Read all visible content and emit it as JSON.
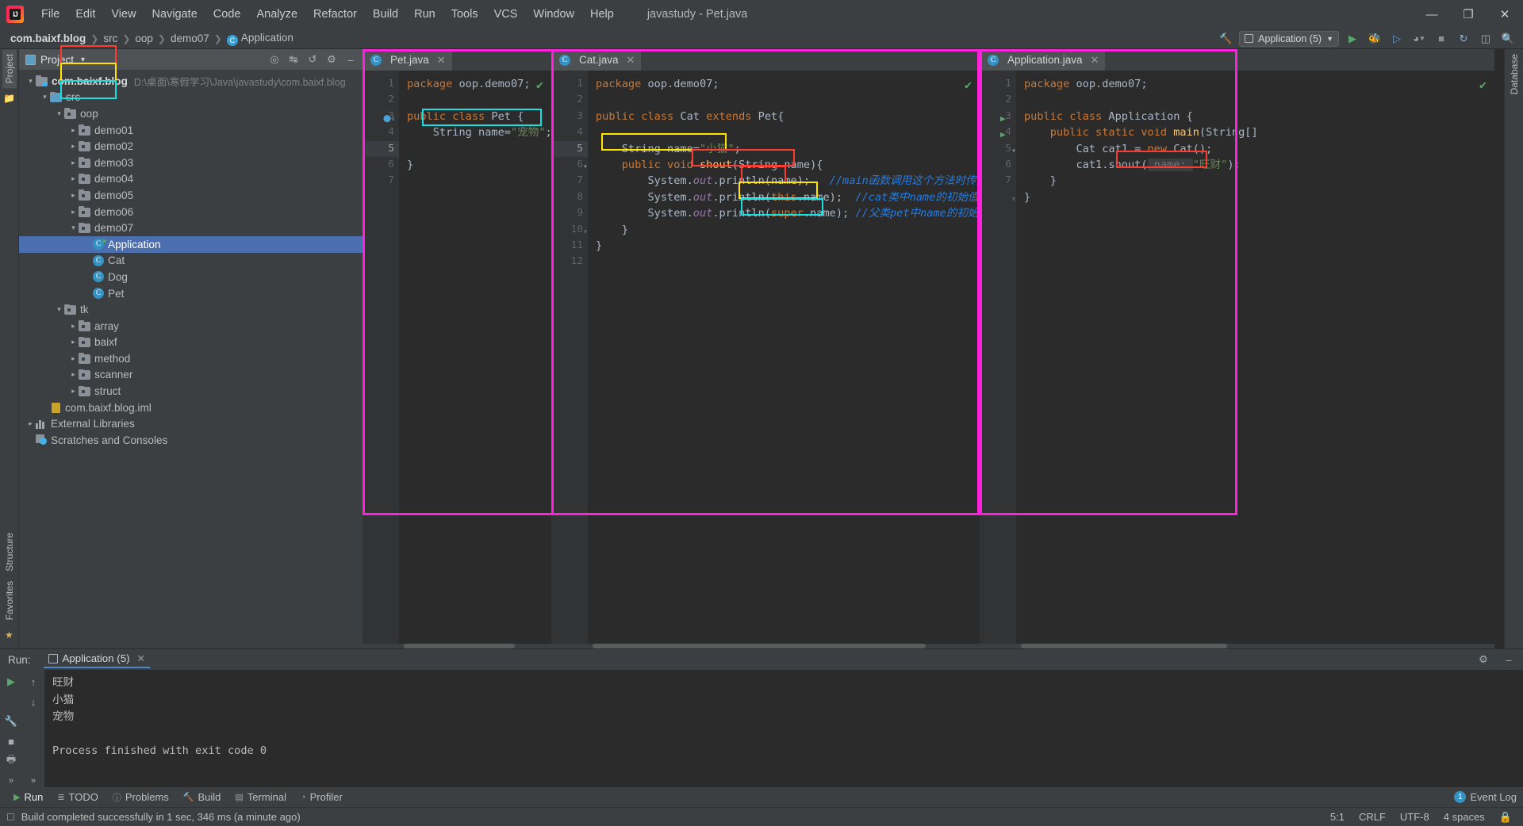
{
  "window": {
    "title": "javastudy - Pet.java",
    "minimize": "—",
    "maximize": "❐",
    "close": "✕"
  },
  "menubar": {
    "logo": "ij-logo",
    "items": [
      "File",
      "Edit",
      "View",
      "Navigate",
      "Code",
      "Analyze",
      "Refactor",
      "Build",
      "Run",
      "Tools",
      "VCS",
      "Window",
      "Help"
    ]
  },
  "navbar": {
    "crumbs": [
      "com.baixf.blog",
      "src",
      "oop",
      "demo07",
      "Application"
    ],
    "run_config": "Application (5)",
    "icons": [
      "hammer-icon",
      "run-icon",
      "debug-icon",
      "run-coverage-icon",
      "profiler-icon",
      "stop-icon",
      "update-icon",
      "layout-icon",
      "search-icon"
    ]
  },
  "left_rail": {
    "tabs": [
      "Project"
    ],
    "bottom_tabs": [
      "Structure",
      "Favorites"
    ]
  },
  "right_rail": {
    "tabs": [
      "Database"
    ]
  },
  "project_panel": {
    "title": "Project",
    "toolbar_icons": [
      "locate-icon",
      "collapse-all-icon",
      "expand-icon",
      "settings-gear-icon",
      "hide-icon"
    ],
    "tree": [
      {
        "depth": 0,
        "arrow": "down",
        "icon": "module-folder",
        "label": "com.baixf.blog",
        "bold": true,
        "path": "D:\\桌面\\寒假学习\\Java\\javastudy\\com.baixf.blog",
        "selected": false
      },
      {
        "depth": 1,
        "arrow": "down",
        "icon": "src-folder",
        "label": "src",
        "bold": false,
        "path": "",
        "selected": false
      },
      {
        "depth": 2,
        "arrow": "down",
        "icon": "package-folder",
        "label": "oop",
        "bold": false,
        "path": "",
        "selected": false
      },
      {
        "depth": 3,
        "arrow": "right",
        "icon": "package-folder",
        "label": "demo01",
        "bold": false,
        "path": "",
        "selected": false
      },
      {
        "depth": 3,
        "arrow": "right",
        "icon": "package-folder",
        "label": "demo02",
        "bold": false,
        "path": "",
        "selected": false
      },
      {
        "depth": 3,
        "arrow": "right",
        "icon": "package-folder",
        "label": "demo03",
        "bold": false,
        "path": "",
        "selected": false
      },
      {
        "depth": 3,
        "arrow": "right",
        "icon": "package-folder",
        "label": "demo04",
        "bold": false,
        "path": "",
        "selected": false
      },
      {
        "depth": 3,
        "arrow": "right",
        "icon": "package-folder",
        "label": "demo05",
        "bold": false,
        "path": "",
        "selected": false
      },
      {
        "depth": 3,
        "arrow": "right",
        "icon": "package-folder",
        "label": "demo06",
        "bold": false,
        "path": "",
        "selected": false
      },
      {
        "depth": 3,
        "arrow": "down",
        "icon": "package-folder",
        "label": "demo07",
        "bold": false,
        "path": "",
        "selected": false
      },
      {
        "depth": 4,
        "arrow": "none",
        "icon": "class-runnable",
        "label": "Application",
        "bold": false,
        "path": "",
        "selected": true
      },
      {
        "depth": 4,
        "arrow": "none",
        "icon": "class",
        "label": "Cat",
        "bold": false,
        "path": "",
        "selected": false
      },
      {
        "depth": 4,
        "arrow": "none",
        "icon": "class",
        "label": "Dog",
        "bold": false,
        "path": "",
        "selected": false
      },
      {
        "depth": 4,
        "arrow": "none",
        "icon": "class",
        "label": "Pet",
        "bold": false,
        "path": "",
        "selected": false
      },
      {
        "depth": 2,
        "arrow": "down",
        "icon": "package-folder",
        "label": "tk",
        "bold": false,
        "path": "",
        "selected": false
      },
      {
        "depth": 3,
        "arrow": "right",
        "icon": "package-folder",
        "label": "array",
        "bold": false,
        "path": "",
        "selected": false
      },
      {
        "depth": 3,
        "arrow": "right",
        "icon": "package-folder",
        "label": "baixf",
        "bold": false,
        "path": "",
        "selected": false
      },
      {
        "depth": 3,
        "arrow": "right",
        "icon": "package-folder",
        "label": "method",
        "bold": false,
        "path": "",
        "selected": false
      },
      {
        "depth": 3,
        "arrow": "right",
        "icon": "package-folder",
        "label": "scanner",
        "bold": false,
        "path": "",
        "selected": false
      },
      {
        "depth": 3,
        "arrow": "right",
        "icon": "package-folder",
        "label": "struct",
        "bold": false,
        "path": "",
        "selected": false
      },
      {
        "depth": 1,
        "arrow": "none",
        "icon": "iml-file",
        "label": "com.baixf.blog.iml",
        "bold": false,
        "path": "",
        "selected": false
      },
      {
        "depth": 0,
        "arrow": "right",
        "icon": "library",
        "label": "External Libraries",
        "bold": false,
        "path": "",
        "selected": false
      },
      {
        "depth": 0,
        "arrow": "none",
        "icon": "scratches",
        "label": "Scratches and Consoles",
        "bold": false,
        "path": "",
        "selected": false
      }
    ]
  },
  "editors": [
    {
      "tab": "Pet.java",
      "tab_icon": "class-icon",
      "close": "✕",
      "inspection": "✔",
      "lines": [
        "1",
        "2",
        "3",
        "4",
        "5",
        "6",
        "7"
      ],
      "current_line": 5,
      "gutter_marks": {
        "3": "field-marker"
      },
      "code": [
        [
          {
            "t": "package ",
            "c": "kw"
          },
          {
            "t": "oop.demo07;",
            "c": "cls"
          }
        ],
        [],
        [
          {
            "t": "public class ",
            "c": "kw"
          },
          {
            "t": "Pet {",
            "c": "cls"
          }
        ],
        [
          {
            "t": "    String name=",
            "c": "cls"
          },
          {
            "t": "\"宠物\"",
            "c": "str"
          },
          {
            "t": ";",
            "c": "cls"
          }
        ],
        [],
        [
          {
            "t": "}",
            "c": "cls"
          }
        ],
        []
      ]
    },
    {
      "tab": "Cat.java",
      "tab_icon": "class-icon",
      "close": "✕",
      "inspection": "✔",
      "lines": [
        "1",
        "2",
        "3",
        "4",
        "5",
        "6",
        "7",
        "8",
        "9",
        "10",
        "11",
        "12"
      ],
      "current_line": 5,
      "code": [
        [
          {
            "t": "package ",
            "c": "kw"
          },
          {
            "t": "oop.demo07;",
            "c": "cls"
          }
        ],
        [],
        [
          {
            "t": "public class ",
            "c": "kw"
          },
          {
            "t": "Cat ",
            "c": "cls"
          },
          {
            "t": "extends ",
            "c": "kw"
          },
          {
            "t": "Pet{",
            "c": "cls"
          }
        ],
        [],
        [
          {
            "t": "    String name=",
            "c": "cls"
          },
          {
            "t": "\"小猫\"",
            "c": "str"
          },
          {
            "t": ";",
            "c": "cls"
          }
        ],
        [
          {
            "t": "    ",
            "c": "cls"
          },
          {
            "t": "public void ",
            "c": "kw"
          },
          {
            "t": "shout",
            "c": "mth"
          },
          {
            "t": "(String name){",
            "c": "cls"
          }
        ],
        [
          {
            "t": "        System.",
            "c": "cls"
          },
          {
            "t": "out",
            "c": "ital"
          },
          {
            "t": ".println(name);   ",
            "c": "cls"
          },
          {
            "t": "//main函数调用这个方法时传进来的参数",
            "c": "cmt"
          }
        ],
        [
          {
            "t": "        System.",
            "c": "cls"
          },
          {
            "t": "out",
            "c": "ital"
          },
          {
            "t": ".println(",
            "c": "cls"
          },
          {
            "t": "this",
            "c": "kw"
          },
          {
            "t": ".name);  ",
            "c": "cls"
          },
          {
            "t": "//cat类中name的初始值",
            "c": "cmt"
          }
        ],
        [
          {
            "t": "        System.",
            "c": "cls"
          },
          {
            "t": "out",
            "c": "ital"
          },
          {
            "t": ".println(",
            "c": "cls"
          },
          {
            "t": "super",
            "c": "kw"
          },
          {
            "t": ".name); ",
            "c": "cls"
          },
          {
            "t": "//父类pet中name的初始值",
            "c": "cmt"
          }
        ],
        [
          {
            "t": "    }",
            "c": "cls"
          }
        ],
        [
          {
            "t": "}",
            "c": "cls"
          }
        ],
        []
      ]
    },
    {
      "tab": "Application.java",
      "tab_icon": "class-icon",
      "close": "✕",
      "inspection": "✔",
      "lines": [
        "1",
        "2",
        "3",
        "4",
        "5",
        "6",
        "7"
      ],
      "current_line": 0,
      "gutter_marks": {
        "3": "run-marker",
        "4": "run-marker"
      },
      "code": [
        [
          {
            "t": "package ",
            "c": "kw"
          },
          {
            "t": "oop.demo07;",
            "c": "cls"
          }
        ],
        [],
        [
          {
            "t": "public class ",
            "c": "kw"
          },
          {
            "t": "Application {",
            "c": "cls"
          }
        ],
        [
          {
            "t": "    ",
            "c": "cls"
          },
          {
            "t": "public static void ",
            "c": "kw"
          },
          {
            "t": "main",
            "c": "mth"
          },
          {
            "t": "(String[]",
            "c": "cls"
          }
        ],
        [
          {
            "t": "        Cat cat1 = ",
            "c": "cls"
          },
          {
            "t": "new ",
            "c": "kw"
          },
          {
            "t": "Cat();",
            "c": "cls"
          }
        ],
        [
          {
            "t": "        cat1.shout(",
            "c": "cls"
          },
          {
            "t": " name: ",
            "c": "hint"
          },
          {
            "t": "\"旺财\"",
            "c": "str"
          },
          {
            "t": ");",
            "c": "cls"
          }
        ],
        [
          {
            "t": "    }",
            "c": "cls"
          }
        ],
        [
          {
            "t": "}",
            "c": "cls"
          }
        ]
      ]
    }
  ],
  "annotations": {
    "colors": {
      "cyan": "#18e0e0",
      "yellow": "#ffe500",
      "red": "#ff3b30",
      "magenta": "#ff22dd"
    },
    "note": "highlight boxes linking fields to console output"
  },
  "run_panel": {
    "label": "Run:",
    "tab": "Application (5)",
    "tab_close": "✕",
    "toolbar_icons": [
      "run-icon",
      "up-arrow-icon",
      "down-arrow-icon",
      "wrench-icon",
      "stop-icon",
      "print-icon",
      "more-icon"
    ],
    "settings_icon": "gear-icon",
    "hide_icon": "minimize-icon",
    "console_lines": [
      "旺财",
      "小猫",
      "宠物",
      "",
      "Process finished with exit code 0"
    ]
  },
  "bottom_bar": {
    "items": [
      {
        "label": "Run",
        "icon": "play-icon",
        "active": true
      },
      {
        "label": "TODO",
        "icon": "todo-icon",
        "active": false
      },
      {
        "label": "Problems",
        "icon": "problems-icon",
        "active": false
      },
      {
        "label": "Build",
        "icon": "build-icon",
        "active": false
      },
      {
        "label": "Terminal",
        "icon": "terminal-icon",
        "active": false
      },
      {
        "label": "Profiler",
        "icon": "profiler-icon",
        "active": false
      }
    ],
    "event_log": "Event Log",
    "event_count": "1"
  },
  "status_bar": {
    "message": "Build completed successfully in 1 sec, 346 ms (a minute ago)",
    "caret": "5:1",
    "line_sep": "CRLF",
    "encoding": "UTF-8",
    "indent": "4 spaces",
    "lock_icon": "lock-icon"
  }
}
